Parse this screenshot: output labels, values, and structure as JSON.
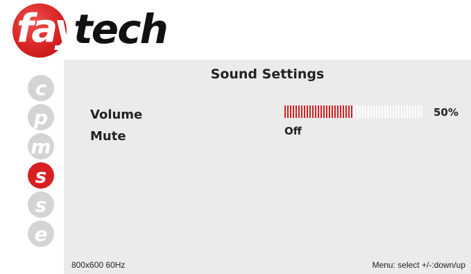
{
  "brand": {
    "part1": "fay",
    "part2": "tech"
  },
  "menu_icons": [
    {
      "letter": "c",
      "active": false
    },
    {
      "letter": "p",
      "active": false
    },
    {
      "letter": "m",
      "active": false
    },
    {
      "letter": "s",
      "active": true
    },
    {
      "letter": "s",
      "active": false
    },
    {
      "letter": "e",
      "active": false
    }
  ],
  "title": "Sound Settings",
  "settings": {
    "volume": {
      "label": "Volume",
      "value_text": "50%",
      "level": 0.5
    },
    "mute": {
      "label": "Mute",
      "value": "Off"
    }
  },
  "status": {
    "resolution": "800x600 60Hz",
    "hint": "Menu: select +/-:down/up"
  },
  "colors": {
    "accent": "#d82020",
    "panel": "#ebebeb",
    "inactive_icon": "#d4d4d4"
  }
}
